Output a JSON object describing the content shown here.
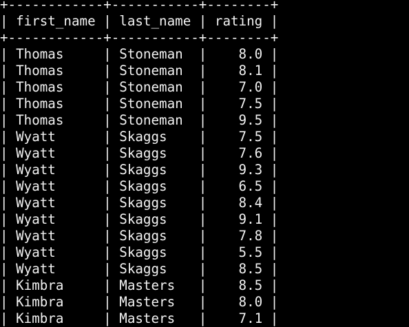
{
  "terminal": {
    "lines": [
      "+------------+-----------+--------+",
      "| first_name | last_name | rating |",
      "+------------+-----------+--------+",
      "| Thomas     | Stoneman  |    8.0 |",
      "| Thomas     | Stoneman  |    8.1 |",
      "| Thomas     | Stoneman  |    7.0 |",
      "| Thomas     | Stoneman  |    7.5 |",
      "| Thomas     | Stoneman  |    9.5 |",
      "| Wyatt      | Skaggs    |    7.5 |",
      "| Wyatt      | Skaggs    |    7.6 |",
      "| Wyatt      | Skaggs    |    9.3 |",
      "| Wyatt      | Skaggs    |    6.5 |",
      "| Wyatt      | Skaggs    |    8.4 |",
      "| Wyatt      | Skaggs    |    9.1 |",
      "| Wyatt      | Skaggs    |    7.8 |",
      "| Wyatt      | Skaggs    |    5.5 |",
      "| Wyatt      | Skaggs    |    8.5 |",
      "| Kimbra     | Masters   |    8.5 |",
      "| Kimbra     | Masters   |    8.0 |",
      "| Kimbra     | Masters   |    7.1 |"
    ]
  }
}
